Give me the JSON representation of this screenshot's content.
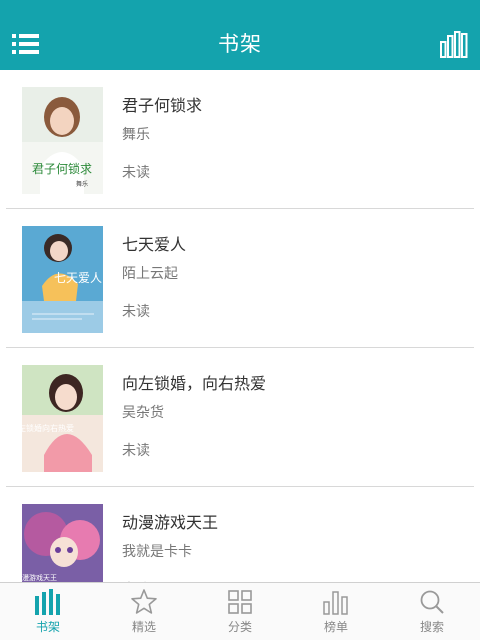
{
  "header": {
    "title": "书架",
    "menu_icon": "menu-icon",
    "shelf_icon": "bookshelf-icon"
  },
  "colors": {
    "accent": "#14a3ad",
    "inactive": "#888888"
  },
  "books": [
    {
      "title": "君子何锁求",
      "author": "舞乐",
      "status": "未读",
      "cover_text": "君子何锁求"
    },
    {
      "title": "七天爱人",
      "author": "陌上云起",
      "status": "未读",
      "cover_text": "七天爱人"
    },
    {
      "title": "向左锁婚，向右热爱",
      "author": "吴杂货",
      "status": "未读",
      "cover_text": "向左锁婚向右热爱"
    },
    {
      "title": "动漫游戏天王",
      "author": "我就是卡卡",
      "status": "未读",
      "cover_text": "动漫游戏天王"
    }
  ],
  "tabs": [
    {
      "label": "书架",
      "icon": "bookshelf-icon",
      "active": true
    },
    {
      "label": "精选",
      "icon": "star-icon",
      "active": false
    },
    {
      "label": "分类",
      "icon": "grid-icon",
      "active": false
    },
    {
      "label": "榜单",
      "icon": "ranking-icon",
      "active": false
    },
    {
      "label": "搜索",
      "icon": "search-icon",
      "active": false
    }
  ]
}
